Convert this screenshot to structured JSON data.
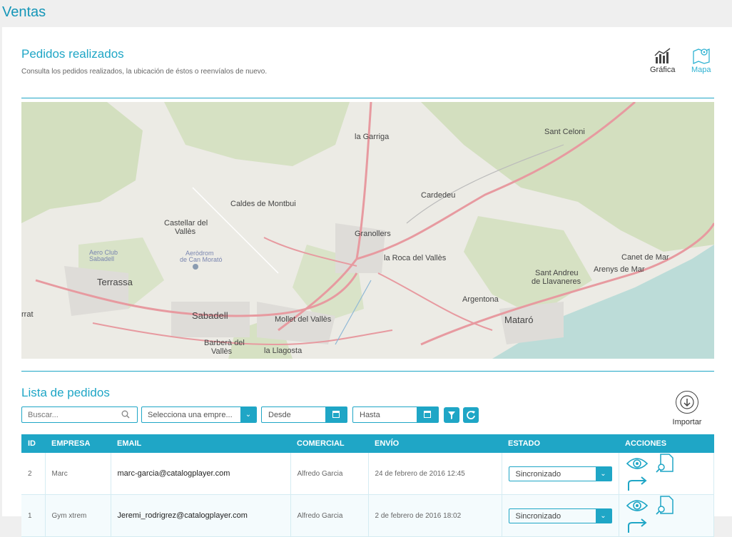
{
  "header": {
    "title": "Ventas"
  },
  "orders_section": {
    "title": "Pedidos realizados",
    "subtitle": "Consulta los pedidos realizados, la ubicación de éstos o reenvíalos de nuevo.",
    "views": [
      {
        "label": "Gráfica",
        "icon": "bar-chart-icon",
        "active": false
      },
      {
        "label": "Mapa",
        "icon": "map-pin-icon",
        "active": true
      }
    ]
  },
  "map": {
    "labels": {
      "la_garriga": "la Garriga",
      "sant_celoni": "Sant Celoni",
      "cardedeu": "Cardedeu",
      "caldes": "Caldes de Montbui",
      "castellar": "Castellar del",
      "castellar2": "Vallès",
      "granollers": "Granollers",
      "la_roca": "la Roca del Vallès",
      "canet": "Canet de Mar",
      "sant_andreu": "Sant Andreu",
      "sant_andreu2": "de Llavaneres",
      "arenys": "Arenys de Mar",
      "terrassa": "Terrassa",
      "sabadell": "Sabadell",
      "mollet": "Mollet del Vallès",
      "argentona": "Argentona",
      "mataro": "Mataró",
      "barbera": "Barberà del",
      "barbera2": "Vallès",
      "llagosta": "la Llagosta",
      "rrat": "rrat",
      "aerodrom": "Aeròdrom",
      "aerodrom2": "de Can Morató",
      "aeroclub": "Aero Club",
      "aeroclub2": "Sabadell"
    },
    "colors": {
      "land": "#ecebe5",
      "forest": "#d3dfbf",
      "sea": "#bcdcd8",
      "road": "#e79aa0",
      "urban": "#dedcd8"
    }
  },
  "list": {
    "title": "Lista de pedidos",
    "search_placeholder": "Buscar...",
    "company_select": "Selecciona una empre...",
    "desde_placeholder": "Desde",
    "hasta_placeholder": "Hasta",
    "import_label": "Importar",
    "columns": [
      "ID",
      "EMPRESA",
      "EMAIL",
      "COMERCIAL",
      "ENVÍO",
      "ESTADO",
      "ACCIONES"
    ],
    "rows": [
      {
        "id": "2",
        "empresa": "Marc",
        "email": "marc-garcia@catalogplayer.com",
        "comercial": "Alfredo Garcia",
        "envio": "24 de febrero de 2016 12:45",
        "estado": "Sincronizado"
      },
      {
        "id": "1",
        "empresa": "Gym xtrem",
        "email": "Jeremi_rodrigrez@catalogplayer.com",
        "comercial": "Alfredo Garcia",
        "envio": "2 de febrero de 2016 18:02",
        "estado": "Sincronizado"
      }
    ]
  },
  "accent_color": "#1fa6c6"
}
